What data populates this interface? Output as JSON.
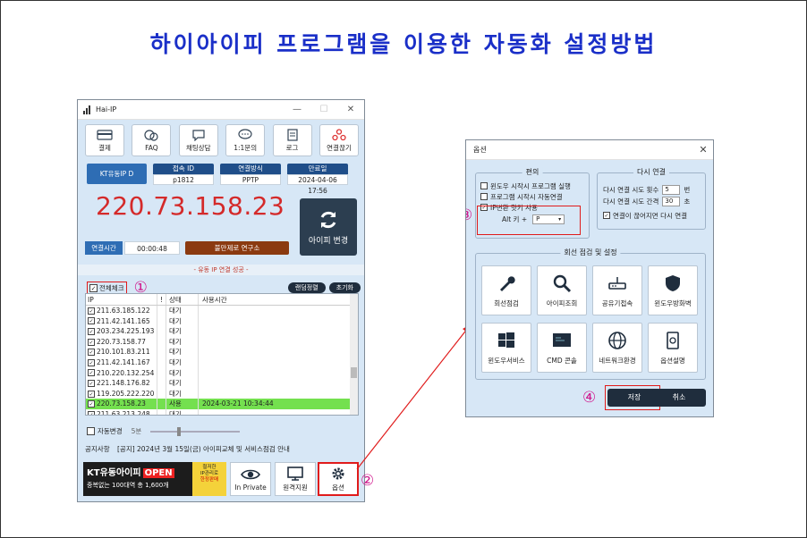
{
  "page_title": "하이아이피 프로그램을 이용한 자동화 설정방법",
  "main_window": {
    "title": "Hai-IP",
    "window_controls": [
      "—",
      "☐",
      "✕"
    ],
    "toolbar": [
      {
        "label": "결제",
        "icon": "payment-card-icon"
      },
      {
        "label": "FAQ",
        "icon": "faq-icon"
      },
      {
        "label": "채팅상담",
        "icon": "chat-icon"
      },
      {
        "label": "1:1문의",
        "icon": "inquiry-icon"
      },
      {
        "label": "로그",
        "icon": "log-icon"
      },
      {
        "label": "연결끊기",
        "icon": "disconnect-icon"
      }
    ],
    "ip_type": "KT유동IP D",
    "info": [
      {
        "header": "접속 ID",
        "value": "p1812"
      },
      {
        "header": "연결방식",
        "value": "PPTP"
      },
      {
        "header": "만료일",
        "value": "2024-04-06 17:56"
      }
    ],
    "current_ip": "220.73.158.23",
    "change_button": "아이피 변경",
    "connect_time_label": "연결시간",
    "connect_time": "00:00:48",
    "connect_msg": "불만제로 연구소",
    "status": "- 유동 IP 연결 성공 -",
    "check_all": "전체체크",
    "random_sort": "랜덤정렬",
    "reset": "초기화",
    "list_headers": {
      "ip": "IP",
      "flag": "!",
      "status": "상태",
      "time": "사용시간"
    },
    "list_rows": [
      {
        "ip": "211.63.185.122",
        "status": "대기",
        "time": "",
        "selected": false
      },
      {
        "ip": "211.42.141.165",
        "status": "대기",
        "time": "",
        "selected": false
      },
      {
        "ip": "203.234.225.193",
        "status": "대기",
        "time": "",
        "selected": false
      },
      {
        "ip": "220.73.158.77",
        "status": "대기",
        "time": "",
        "selected": false
      },
      {
        "ip": "210.101.83.211",
        "status": "대기",
        "time": "",
        "selected": false
      },
      {
        "ip": "211.42.141.167",
        "status": "대기",
        "time": "",
        "selected": false
      },
      {
        "ip": "210.220.132.254",
        "status": "대기",
        "time": "",
        "selected": false
      },
      {
        "ip": "221.148.176.82",
        "status": "대기",
        "time": "",
        "selected": false
      },
      {
        "ip": "119.205.222.220",
        "status": "대기",
        "time": "",
        "selected": false
      },
      {
        "ip": "220.73.158.23",
        "status": "사용",
        "time": "2024-03-21 10:34:44",
        "selected": true
      },
      {
        "ip": "211.63.213.248",
        "status": "대기",
        "time": "",
        "selected": false
      }
    ],
    "auto_change": "자동변경",
    "auto_interval": "5분",
    "notice_label": "공지사항",
    "notice_text": "[공지] 2024년 3월 15일(금) 아이피교체 및 서비스점검 안내",
    "banner": {
      "line1": "KT유동아이피",
      "open": "OPEN",
      "line2": "중복없는 100대역 총 1,600개",
      "side1": "철저한",
      "side2": "IP관리로",
      "side3": "한정판매"
    },
    "bottom_buttons": [
      {
        "label": "In Private",
        "icon": "eye-icon"
      },
      {
        "label": "원격지원",
        "icon": "remote-monitor-icon"
      },
      {
        "label": "옵션",
        "icon": "gear-icon"
      }
    ]
  },
  "options_dialog": {
    "title": "옵션",
    "convenience_title": "편의",
    "convenience_opts": [
      {
        "label": "윈도우 시작시 프로그램 실행",
        "checked": false
      },
      {
        "label": "프로그램 시작시 자동연결",
        "checked": false
      },
      {
        "label": "IP변환 핫키 사용",
        "checked": true
      }
    ],
    "alt_key_label": "Alt 키 +",
    "alt_key_value": "P",
    "reconnect_title": "다시 연결",
    "reconnect_count_label": "다시 연결 시도 횟수",
    "reconnect_count": "5",
    "reconnect_count_unit": "번",
    "reconnect_interval_label": "다시 연결 시도 간격",
    "reconnect_interval": "30",
    "reconnect_interval_unit": "초",
    "reconnect_auto_label": "연결이 끊어지면 다시 연결",
    "tools_title": "회선 점검 및 설정",
    "tools": [
      {
        "label": "회선점검",
        "icon": "wrench-icon"
      },
      {
        "label": "아이피조회",
        "icon": "search-icon"
      },
      {
        "label": "공유기접속",
        "icon": "router-icon"
      },
      {
        "label": "윈도우방화벽",
        "icon": "shield-icon"
      },
      {
        "label": "윈도우서비스",
        "icon": "windows-icon"
      },
      {
        "label": "CMD 콘솔",
        "icon": "console-icon"
      },
      {
        "label": "네트워크환경",
        "icon": "globe-icon"
      },
      {
        "label": "옵션설명",
        "icon": "manual-icon"
      }
    ],
    "save": "저장",
    "cancel": "취소"
  },
  "annotations": [
    "①",
    "②",
    "③",
    "④"
  ],
  "colors": {
    "title_blue": "#1a2fc8",
    "ip_red": "#d42a2a",
    "annotation_magenta": "#d0168c",
    "highlight_red": "#e01b1b",
    "selected_row": "#74e04f"
  }
}
